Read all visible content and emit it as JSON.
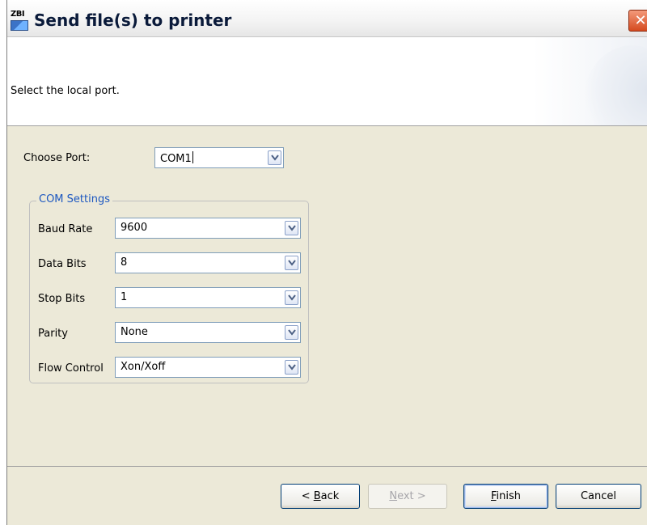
{
  "window": {
    "icon_text": "ZBI",
    "title": "Send file(s) to printer",
    "close_glyph": "✕"
  },
  "header": {
    "instruction": "Select the local port."
  },
  "port": {
    "label": "Choose Port:",
    "value": "COM1"
  },
  "com_settings": {
    "legend": "COM Settings",
    "fields": [
      {
        "label": "Baud Rate",
        "value": "9600"
      },
      {
        "label": "Data Bits",
        "value": "8"
      },
      {
        "label": "Stop Bits",
        "value": "1"
      },
      {
        "label": "Parity",
        "value": "None"
      },
      {
        "label": "Flow Control",
        "value": "Xon/Xoff"
      }
    ]
  },
  "buttons": {
    "back": {
      "prefix": "< ",
      "mnemonic": "B",
      "rest": "ack"
    },
    "next": {
      "mnemonic": "N",
      "rest": "ext >"
    },
    "finish": {
      "mnemonic": "F",
      "rest": "inish"
    },
    "cancel": "Cancel"
  },
  "colors": {
    "dialog_bg": "#ece9d8",
    "legend_text": "#1c57c0",
    "combo_border": "#7f9db9"
  }
}
